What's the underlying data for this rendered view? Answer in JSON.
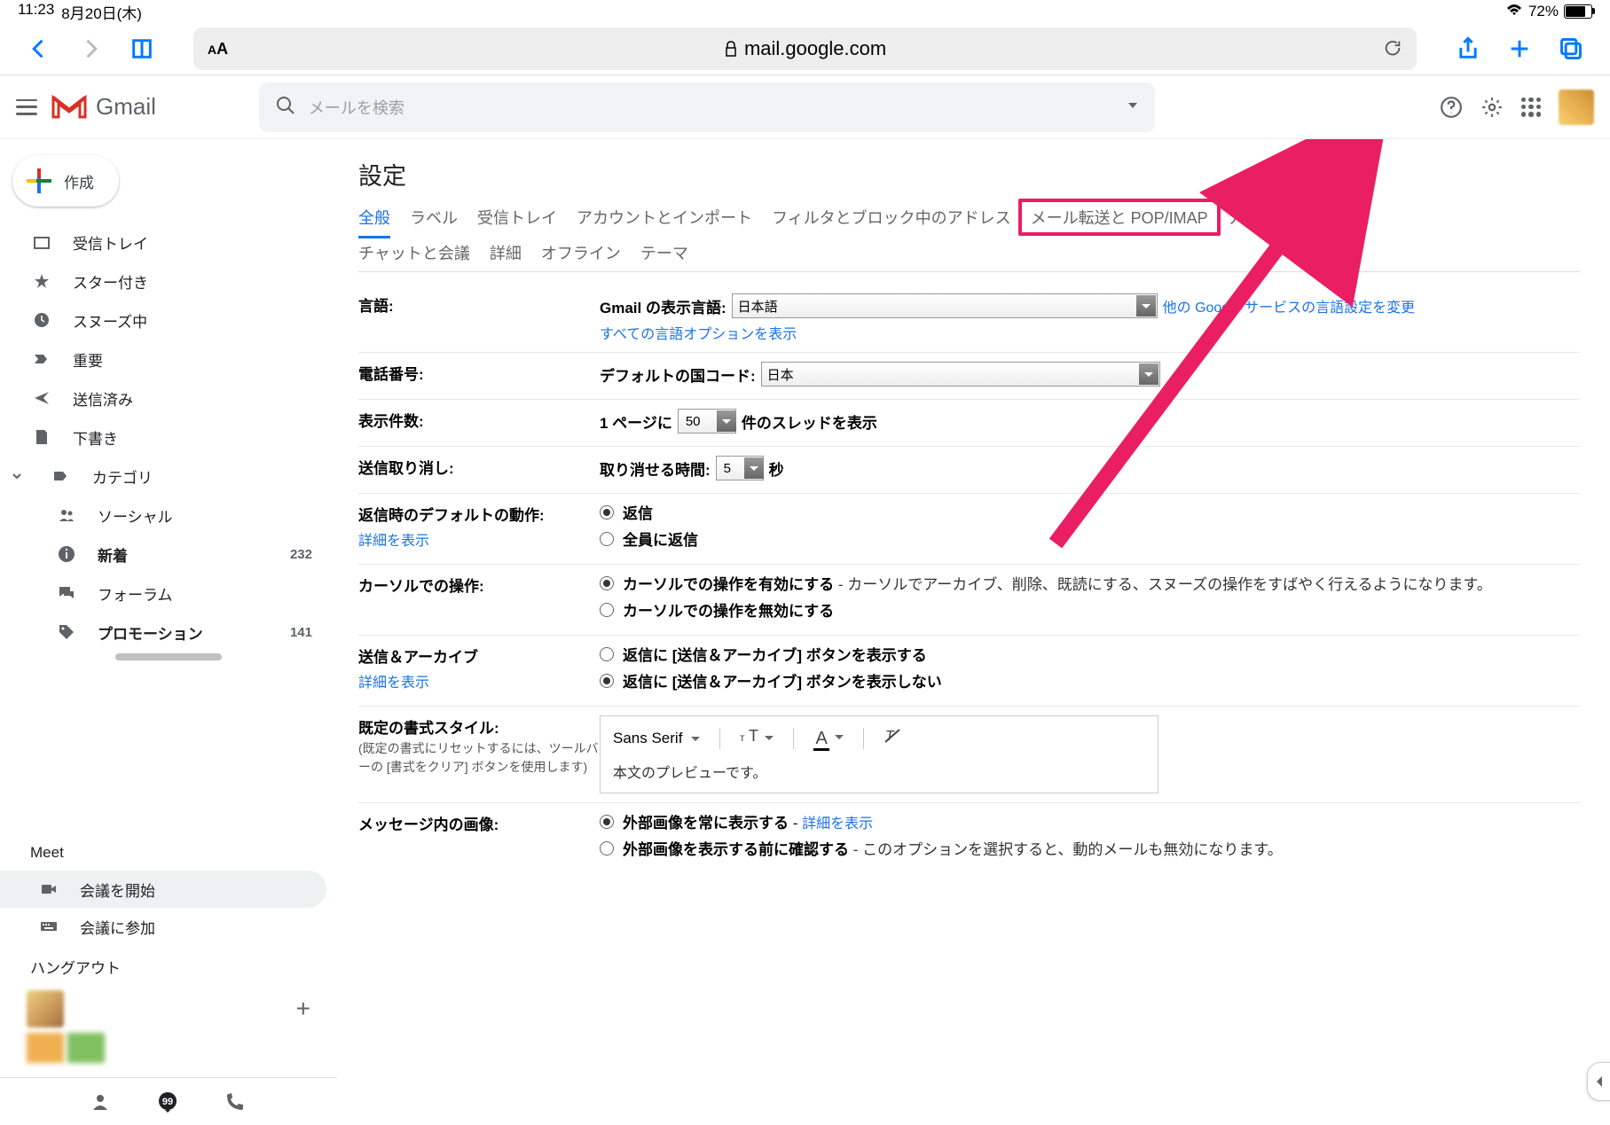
{
  "status": {
    "time": "11:23",
    "date": "8月20日(木)",
    "battery": "72%"
  },
  "safari": {
    "url": "mail.google.com",
    "aa": "AA"
  },
  "gmail": {
    "brand": "Gmail",
    "search_placeholder": "メールを検索",
    "compose": "作成"
  },
  "sidebar": {
    "items": [
      {
        "label": "受信トレイ"
      },
      {
        "label": "スター付き"
      },
      {
        "label": "スヌーズ中"
      },
      {
        "label": "重要"
      },
      {
        "label": "送信済み"
      },
      {
        "label": "下書き"
      },
      {
        "label": "カテゴリ"
      }
    ],
    "subs": [
      {
        "label": "ソーシャル"
      },
      {
        "label": "新着",
        "count": "232"
      },
      {
        "label": "フォーラム"
      },
      {
        "label": "プロモーション",
        "count": "141"
      }
    ]
  },
  "meet": {
    "title": "Meet",
    "start": "会議を開始",
    "join": "会議に参加"
  },
  "hangouts": {
    "title": "ハングアウト"
  },
  "settings": {
    "title": "設定",
    "tabs1": [
      "全般",
      "ラベル",
      "受信トレイ",
      "アカウントとインポート",
      "フィルタとブロック中のアドレス",
      "メール転送と POP/IMAP",
      "アドオン"
    ],
    "tabs2": [
      "チャットと会議",
      "詳細",
      "オフライン",
      "テーマ"
    ],
    "rows": {
      "lang": {
        "label": "言語:",
        "prefix": "Gmail の表示言語:",
        "value": "日本語",
        "link": "他の Google サービスの言語設定を変更",
        "link2": "すべての言語オプションを表示"
      },
      "phone": {
        "label": "電話番号:",
        "prefix": "デフォルトの国コード:",
        "value": "日本"
      },
      "page": {
        "label": "表示件数:",
        "t1": "1 ページに",
        "val": "50",
        "t2": "件のスレッドを表示"
      },
      "undo": {
        "label": "送信取り消し:",
        "t1": "取り消せる時間:",
        "val": "5",
        "t2": "秒"
      },
      "reply": {
        "label": "返信時のデフォルトの動作:",
        "link": "詳細を表示",
        "o1": "返信",
        "o2": "全員に返信"
      },
      "cursor": {
        "label": "カーソルでの操作:",
        "o1b": "カーソルでの操作を有効にする",
        "o1d": " - カーソルでアーカイブ、削除、既読にする、スヌーズの操作をすばやく行えるようになります。",
        "o2": "カーソルでの操作を無効にする"
      },
      "archive": {
        "label": "送信＆アーカイブ",
        "link": "詳細を表示",
        "o1": "返信に [送信＆アーカイブ] ボタンを表示する",
        "o2": "返信に [送信＆アーカイブ] ボタンを表示しない"
      },
      "style": {
        "label": "既定の書式スタイル:",
        "sub": "(既定の書式にリセットするには、ツールバーの [書式をクリア] ボタンを使用します)",
        "font": "Sans Serif",
        "preview": "本文のプレビューです。"
      },
      "images": {
        "label": "メッセージ内の画像:",
        "o1": "外部画像を常に表示する",
        "o1link": "詳細を表示",
        "o2": "外部画像を表示する前に確認する",
        "o2d": " - このオプションを選択すると、動的メールも無効になります。"
      }
    }
  }
}
